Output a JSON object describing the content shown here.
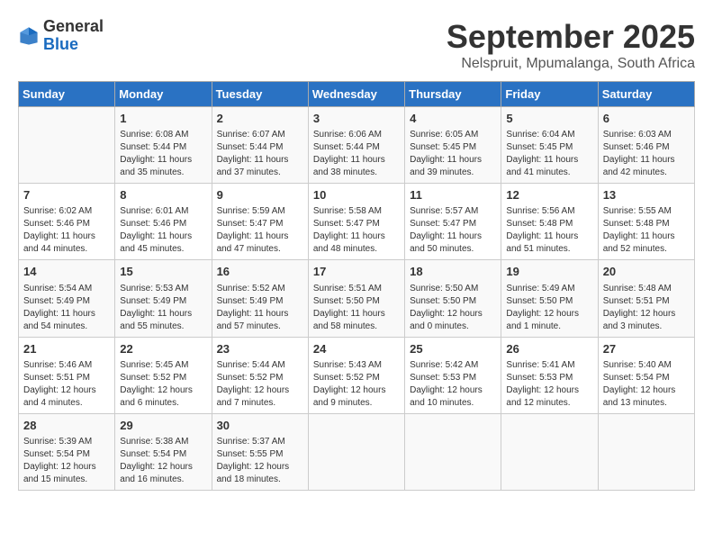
{
  "header": {
    "logo_general": "General",
    "logo_blue": "Blue",
    "month_title": "September 2025",
    "subtitle": "Nelspruit, Mpumalanga, South Africa"
  },
  "weekdays": [
    "Sunday",
    "Monday",
    "Tuesday",
    "Wednesday",
    "Thursday",
    "Friday",
    "Saturday"
  ],
  "weeks": [
    [
      {
        "day": "",
        "info": ""
      },
      {
        "day": "1",
        "info": "Sunrise: 6:08 AM\nSunset: 5:44 PM\nDaylight: 11 hours\nand 35 minutes."
      },
      {
        "day": "2",
        "info": "Sunrise: 6:07 AM\nSunset: 5:44 PM\nDaylight: 11 hours\nand 37 minutes."
      },
      {
        "day": "3",
        "info": "Sunrise: 6:06 AM\nSunset: 5:44 PM\nDaylight: 11 hours\nand 38 minutes."
      },
      {
        "day": "4",
        "info": "Sunrise: 6:05 AM\nSunset: 5:45 PM\nDaylight: 11 hours\nand 39 minutes."
      },
      {
        "day": "5",
        "info": "Sunrise: 6:04 AM\nSunset: 5:45 PM\nDaylight: 11 hours\nand 41 minutes."
      },
      {
        "day": "6",
        "info": "Sunrise: 6:03 AM\nSunset: 5:46 PM\nDaylight: 11 hours\nand 42 minutes."
      }
    ],
    [
      {
        "day": "7",
        "info": "Sunrise: 6:02 AM\nSunset: 5:46 PM\nDaylight: 11 hours\nand 44 minutes."
      },
      {
        "day": "8",
        "info": "Sunrise: 6:01 AM\nSunset: 5:46 PM\nDaylight: 11 hours\nand 45 minutes."
      },
      {
        "day": "9",
        "info": "Sunrise: 5:59 AM\nSunset: 5:47 PM\nDaylight: 11 hours\nand 47 minutes."
      },
      {
        "day": "10",
        "info": "Sunrise: 5:58 AM\nSunset: 5:47 PM\nDaylight: 11 hours\nand 48 minutes."
      },
      {
        "day": "11",
        "info": "Sunrise: 5:57 AM\nSunset: 5:47 PM\nDaylight: 11 hours\nand 50 minutes."
      },
      {
        "day": "12",
        "info": "Sunrise: 5:56 AM\nSunset: 5:48 PM\nDaylight: 11 hours\nand 51 minutes."
      },
      {
        "day": "13",
        "info": "Sunrise: 5:55 AM\nSunset: 5:48 PM\nDaylight: 11 hours\nand 52 minutes."
      }
    ],
    [
      {
        "day": "14",
        "info": "Sunrise: 5:54 AM\nSunset: 5:49 PM\nDaylight: 11 hours\nand 54 minutes."
      },
      {
        "day": "15",
        "info": "Sunrise: 5:53 AM\nSunset: 5:49 PM\nDaylight: 11 hours\nand 55 minutes."
      },
      {
        "day": "16",
        "info": "Sunrise: 5:52 AM\nSunset: 5:49 PM\nDaylight: 11 hours\nand 57 minutes."
      },
      {
        "day": "17",
        "info": "Sunrise: 5:51 AM\nSunset: 5:50 PM\nDaylight: 11 hours\nand 58 minutes."
      },
      {
        "day": "18",
        "info": "Sunrise: 5:50 AM\nSunset: 5:50 PM\nDaylight: 12 hours\nand 0 minutes."
      },
      {
        "day": "19",
        "info": "Sunrise: 5:49 AM\nSunset: 5:50 PM\nDaylight: 12 hours\nand 1 minute."
      },
      {
        "day": "20",
        "info": "Sunrise: 5:48 AM\nSunset: 5:51 PM\nDaylight: 12 hours\nand 3 minutes."
      }
    ],
    [
      {
        "day": "21",
        "info": "Sunrise: 5:46 AM\nSunset: 5:51 PM\nDaylight: 12 hours\nand 4 minutes."
      },
      {
        "day": "22",
        "info": "Sunrise: 5:45 AM\nSunset: 5:52 PM\nDaylight: 12 hours\nand 6 minutes."
      },
      {
        "day": "23",
        "info": "Sunrise: 5:44 AM\nSunset: 5:52 PM\nDaylight: 12 hours\nand 7 minutes."
      },
      {
        "day": "24",
        "info": "Sunrise: 5:43 AM\nSunset: 5:52 PM\nDaylight: 12 hours\nand 9 minutes."
      },
      {
        "day": "25",
        "info": "Sunrise: 5:42 AM\nSunset: 5:53 PM\nDaylight: 12 hours\nand 10 minutes."
      },
      {
        "day": "26",
        "info": "Sunrise: 5:41 AM\nSunset: 5:53 PM\nDaylight: 12 hours\nand 12 minutes."
      },
      {
        "day": "27",
        "info": "Sunrise: 5:40 AM\nSunset: 5:54 PM\nDaylight: 12 hours\nand 13 minutes."
      }
    ],
    [
      {
        "day": "28",
        "info": "Sunrise: 5:39 AM\nSunset: 5:54 PM\nDaylight: 12 hours\nand 15 minutes."
      },
      {
        "day": "29",
        "info": "Sunrise: 5:38 AM\nSunset: 5:54 PM\nDaylight: 12 hours\nand 16 minutes."
      },
      {
        "day": "30",
        "info": "Sunrise: 5:37 AM\nSunset: 5:55 PM\nDaylight: 12 hours\nand 18 minutes."
      },
      {
        "day": "",
        "info": ""
      },
      {
        "day": "",
        "info": ""
      },
      {
        "day": "",
        "info": ""
      },
      {
        "day": "",
        "info": ""
      }
    ]
  ]
}
